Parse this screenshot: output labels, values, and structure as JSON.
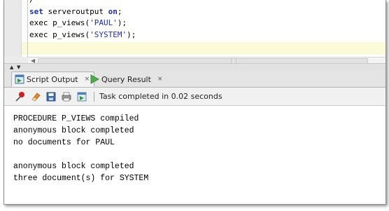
{
  "editor": {
    "lines": [
      {
        "text": "/"
      },
      {
        "kw1": "set",
        "mid": " serveroutput ",
        "kw2": "on",
        "end": ";"
      },
      {
        "pre": "exec p_views(",
        "str": "'PAUL'",
        "end": ");"
      },
      {
        "pre": "exec p_views(",
        "str": "'SYSTEM'",
        "end": ");"
      }
    ]
  },
  "tabs": [
    {
      "label": "Script Output",
      "close": "×",
      "active": true
    },
    {
      "label": "Query Result",
      "close": "×",
      "active": false
    }
  ],
  "toolbar": {
    "status": "Task completed in 0.02 seconds"
  },
  "output": {
    "text": "PROCEDURE P_VIEWS compiled\nanonymous block completed\nno documents for PAUL\n\nanonymous block completed\nthree document(s) for SYSTEM"
  },
  "colors": {
    "keyword": "#1b2db5",
    "current_line": "#fbfbd9"
  },
  "icons": [
    "pushpin-icon",
    "eraser-icon",
    "save-icon",
    "print-icon",
    "export-icon",
    "script-output-icon",
    "query-result-icon"
  ]
}
